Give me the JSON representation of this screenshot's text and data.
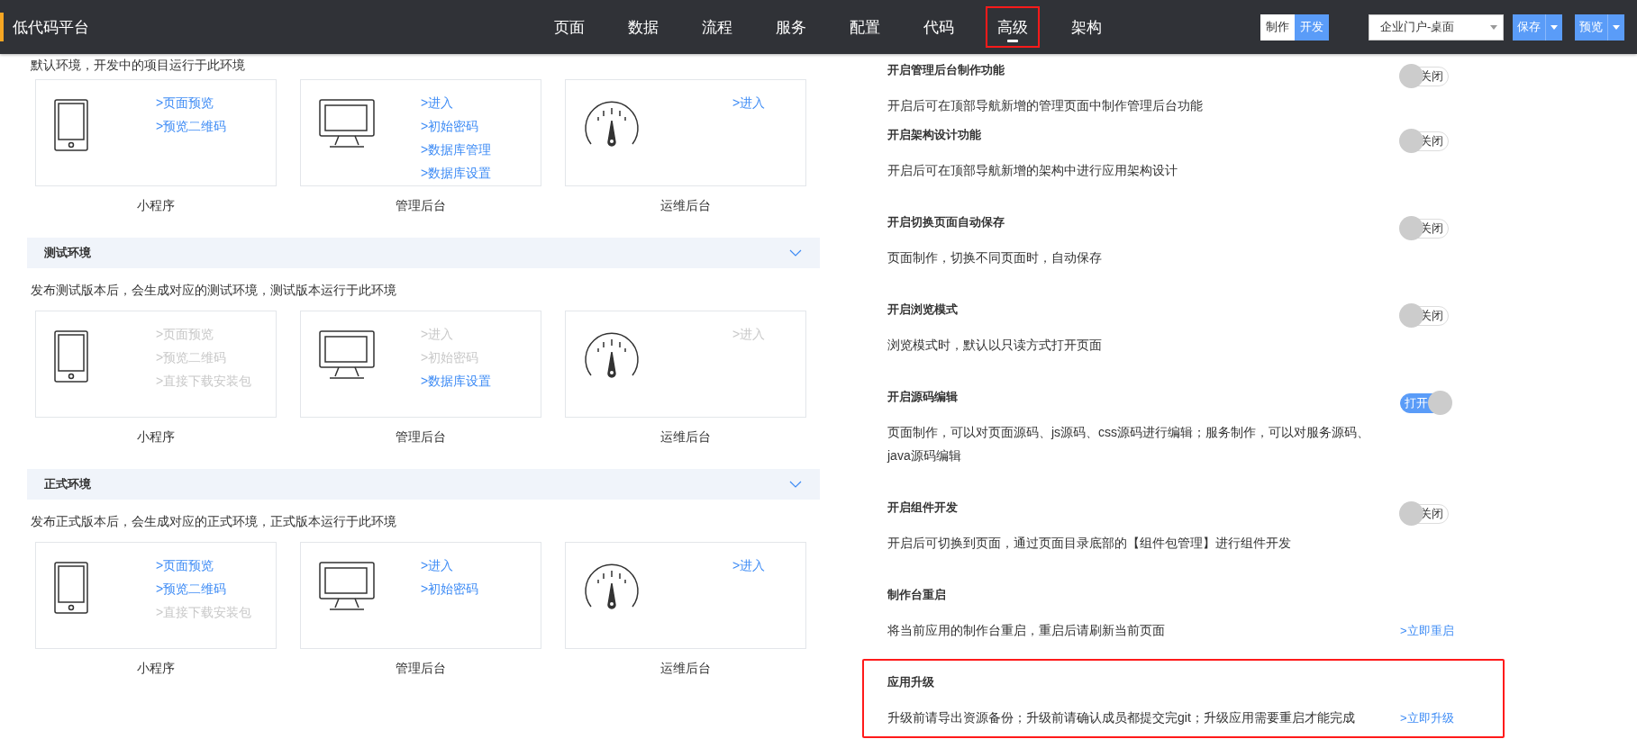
{
  "header": {
    "title": "低代码平台",
    "nav": [
      {
        "label": "页面",
        "selected": false,
        "highlighted": false
      },
      {
        "label": "数据",
        "selected": false,
        "highlighted": false
      },
      {
        "label": "流程",
        "selected": false,
        "highlighted": false
      },
      {
        "label": "服务",
        "selected": false,
        "highlighted": false
      },
      {
        "label": "配置",
        "selected": false,
        "highlighted": false
      },
      {
        "label": "代码",
        "selected": false,
        "highlighted": false
      },
      {
        "label": "高级",
        "selected": true,
        "highlighted": true
      },
      {
        "label": "架构",
        "selected": false,
        "highlighted": false
      }
    ],
    "mode_switch": [
      {
        "label": "制作",
        "selected": false
      },
      {
        "label": "开发",
        "selected": true
      }
    ],
    "app_select": {
      "value": "企业门户-桌面"
    },
    "buttons": [
      {
        "label": "保存"
      },
      {
        "label": "预览"
      }
    ]
  },
  "environments": [
    {
      "description": "默认环境，开发中的项目运行于此环境",
      "cards": [
        {
          "kind": "phone",
          "label": "小程序",
          "links": [
            {
              "text": ">页面预览",
              "disabled": false
            },
            {
              "text": ">预览二维码",
              "disabled": false
            }
          ]
        },
        {
          "kind": "monitor",
          "label": "管理后台",
          "links": [
            {
              "text": ">进入",
              "disabled": false
            },
            {
              "text": ">初始密码",
              "disabled": false
            },
            {
              "text": ">数据库管理",
              "disabled": false
            },
            {
              "text": ">数据库设置",
              "disabled": false
            }
          ]
        },
        {
          "kind": "gauge",
          "label": "运维后台",
          "links": [
            {
              "text": ">进入",
              "disabled": false
            }
          ]
        }
      ]
    },
    {
      "title": "测试环境",
      "description": "发布测试版本后，会生成对应的测试环境，测试版本运行于此环境",
      "cards": [
        {
          "kind": "phone",
          "label": "小程序",
          "links": [
            {
              "text": ">页面预览",
              "disabled": true
            },
            {
              "text": ">预览二维码",
              "disabled": true
            },
            {
              "text": ">直接下载安装包",
              "disabled": true
            }
          ]
        },
        {
          "kind": "monitor",
          "label": "管理后台",
          "links": [
            {
              "text": ">进入",
              "disabled": true
            },
            {
              "text": ">初始密码",
              "disabled": true
            },
            {
              "text": ">数据库设置",
              "disabled": false
            }
          ]
        },
        {
          "kind": "gauge",
          "label": "运维后台",
          "links": [
            {
              "text": ">进入",
              "disabled": true
            }
          ]
        }
      ]
    },
    {
      "title": "正式环境",
      "description": "发布正式版本后，会生成对应的正式环境，正式版本运行于此环境",
      "cards": [
        {
          "kind": "phone",
          "label": "小程序",
          "links": [
            {
              "text": ">页面预览",
              "disabled": false
            },
            {
              "text": ">预览二维码",
              "disabled": false
            },
            {
              "text": ">直接下载安装包",
              "disabled": true
            }
          ]
        },
        {
          "kind": "monitor",
          "label": "管理后台",
          "links": [
            {
              "text": ">进入",
              "disabled": false
            },
            {
              "text": ">初始密码",
              "disabled": false
            }
          ]
        },
        {
          "kind": "gauge",
          "label": "运维后台",
          "links": [
            {
              "text": ">进入",
              "disabled": false
            }
          ]
        }
      ]
    }
  ],
  "settings": [
    {
      "kind": "toggle",
      "title": "开启管理后台制作功能",
      "description": "开启后可在顶部导航新增的管理页面中制作管理后台功能",
      "on": false,
      "toggle_label": "关闭",
      "highlighted": false
    },
    {
      "kind": "toggle",
      "title": "开启架构设计功能",
      "description": "开启后可在顶部导航新增的架构中进行应用架构设计",
      "on": false,
      "toggle_label": "关闭",
      "highlighted": false
    },
    {
      "kind": "toggle",
      "title": "开启切换页面自动保存",
      "description": "页面制作，切换不同页面时，自动保存",
      "on": false,
      "toggle_label": "关闭",
      "highlighted": false
    },
    {
      "kind": "toggle",
      "title": "开启浏览模式",
      "description": "浏览模式时，默认以只读方式打开页面",
      "on": false,
      "toggle_label": "关闭",
      "highlighted": false
    },
    {
      "kind": "toggle",
      "title": "开启源码编辑",
      "description": "页面制作，可以对页面源码、js源码、css源码进行编辑；服务制作，可以对服务源码、java源码编辑",
      "on": true,
      "toggle_label": "打开",
      "highlighted": false
    },
    {
      "kind": "toggle",
      "title": "开启组件开发",
      "description": "开启后可切换到页面，通过页面目录底部的【组件包管理】进行组件开发",
      "on": false,
      "toggle_label": "关闭",
      "highlighted": false
    },
    {
      "kind": "action",
      "title": "制作台重启",
      "description": "将当前应用的制作台重启，重启后请刷新当前页面",
      "action": ">立即重启",
      "highlighted": false
    },
    {
      "kind": "action",
      "title": "应用升级",
      "description": "升级前请导出资源备份；升级前请确认成员都提交完git；升级应用需要重启才能完成",
      "action": ">立即升级",
      "highlighted": true
    }
  ]
}
